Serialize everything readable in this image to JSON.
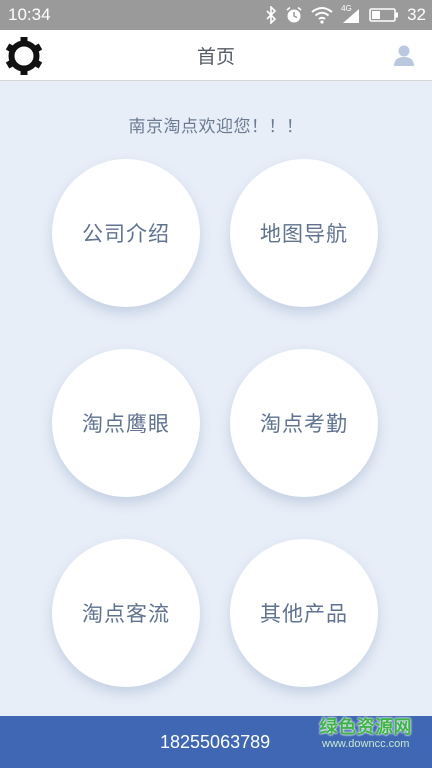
{
  "status_bar": {
    "time": "10:34",
    "battery_level": "32",
    "network_label": "4G",
    "icons": [
      "bluetooth-icon",
      "alarm-icon",
      "wifi-icon",
      "signal-icon",
      "battery-icon"
    ]
  },
  "header": {
    "title": "首页",
    "left_icon": "gear-icon",
    "right_icon": "user-icon"
  },
  "welcome_text": "南京淘点欢迎您！！！",
  "menu": {
    "items": [
      {
        "label": "公司介绍"
      },
      {
        "label": "地图导航"
      },
      {
        "label": "淘点鹰眼"
      },
      {
        "label": "淘点考勤"
      },
      {
        "label": "淘点客流"
      },
      {
        "label": "其他产品"
      }
    ]
  },
  "footer": {
    "phone": "18255063789"
  },
  "watermark": {
    "text": "绿色资源网",
    "url": "www.downcc.com"
  },
  "colors": {
    "background": "#e8eef8",
    "footer": "#3f67b3",
    "circle_text": "#5f7290",
    "watermark_green": "#3fb34a"
  }
}
